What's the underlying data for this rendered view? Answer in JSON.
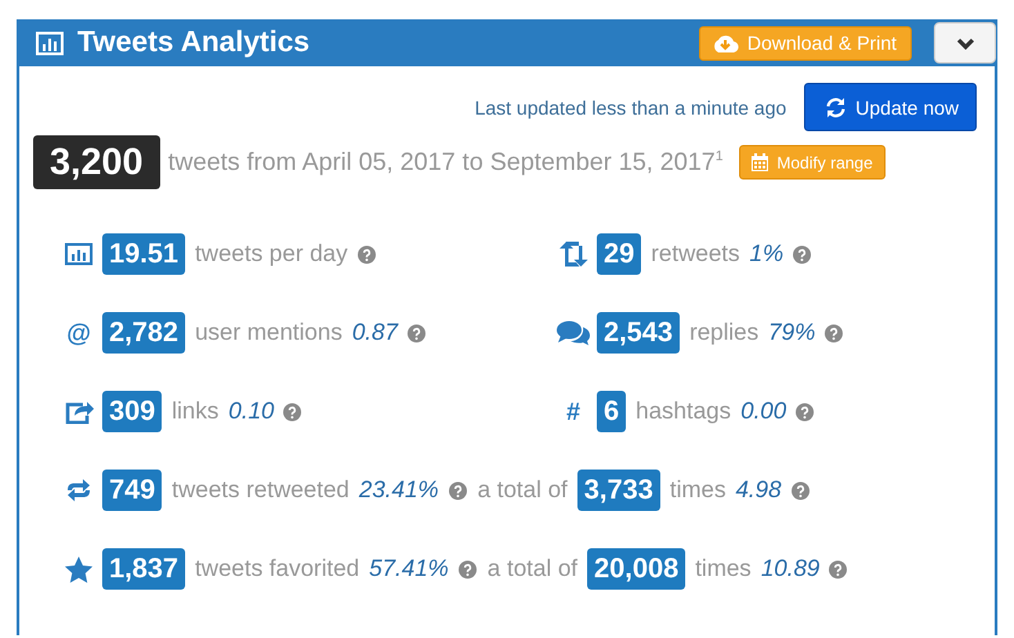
{
  "panel": {
    "title": "Tweets Analytics",
    "download_button": "Download & Print",
    "dropdown_expanded": false
  },
  "update": {
    "status": "Last updated less than a minute ago",
    "button": "Update now"
  },
  "summary": {
    "total": "3,200",
    "range": "tweets from April 05, 2017 to September 15, 2017$^{1}$",
    "modify_button": "Modify range"
  },
  "stat_pairs": [
    [
      {
        "kind": "chart",
        "value": "19.51",
        "label": "tweets per day"
      },
      {
        "kind": "retweet",
        "value": "29",
        "label": "retweets",
        "ratio": "1%"
      }
    ],
    [
      {
        "kind": "glyph",
        "glyph": "@",
        "value": "2,782",
        "label": "user mentions",
        "ratio": "0.87"
      },
      {
        "kind": "replies",
        "value": "2,543",
        "label": "replies",
        "ratio": "79%"
      }
    ],
    [
      {
        "kind": "share",
        "value": "309",
        "label": "links",
        "ratio": "0.10"
      },
      {
        "kind": "glyph",
        "glyph": "#",
        "value": "6",
        "label": "hashtags",
        "ratio": "0.00"
      }
    ]
  ],
  "wide_stats": [
    {
      "kind": "retweeted",
      "value": "749",
      "label": "tweets retweeted",
      "ratio": "23.41%",
      "joiner": "a total of",
      "total": "3,733",
      "unit": "times",
      "unit_ratio": "4.98"
    },
    {
      "kind": "star",
      "value": "1,837",
      "label": "tweets favorited",
      "ratio": "57.41%",
      "joiner": "a total of",
      "total": "20,008",
      "unit": "times",
      "unit_ratio": "10.89"
    }
  ]
}
